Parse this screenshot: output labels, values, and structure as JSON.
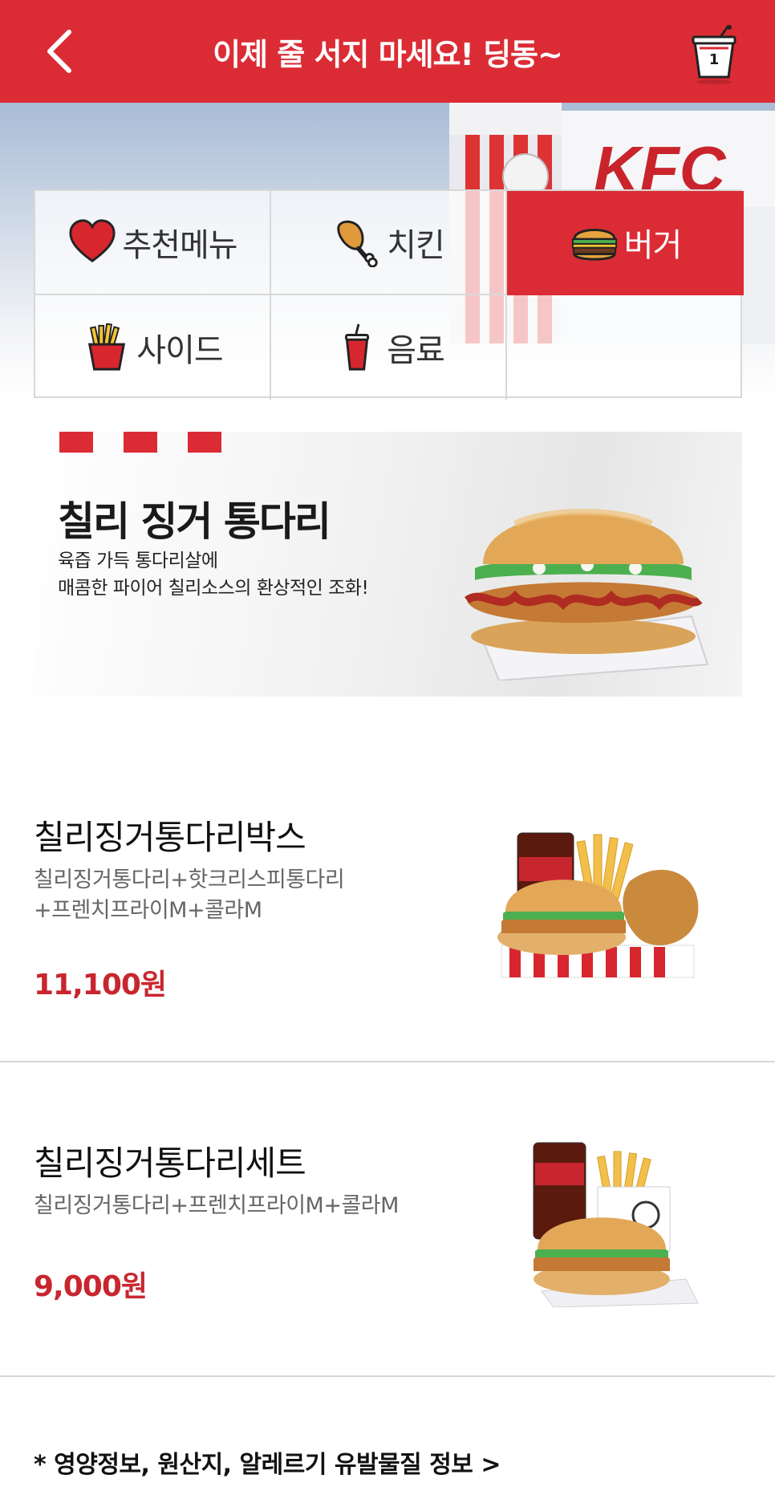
{
  "header": {
    "title": "이제 줄 서지 마세요! 딩동~",
    "cart_count": "1"
  },
  "hero": {
    "sign_text": "KFC"
  },
  "categories": [
    {
      "label": "추천메뉴",
      "icon": "heart-icon"
    },
    {
      "label": "치킨",
      "icon": "drumstick-icon"
    },
    {
      "label": "버거",
      "icon": "burger-icon",
      "active": true
    },
    {
      "label": "사이드",
      "icon": "fries-icon"
    },
    {
      "label": "음료",
      "icon": "drink-icon"
    }
  ],
  "banner": {
    "title": "칠리 징거 통다리",
    "desc_line1": "육즙 가득 통다리살에",
    "desc_line2": "매콤한 파이어 칠리소스의 환상적인 조화!"
  },
  "menu_items": [
    {
      "name": "칠리징거통다리박스",
      "desc_line1": "칠리징거통다리+핫크리스피통다리",
      "desc_line2": "+프렌치프라이M+콜라M",
      "price": "11,100원"
    },
    {
      "name": "칠리징거통다리세트",
      "desc_line1": "칠리징거통다리+프렌치프라이M+콜라M",
      "desc_line2": "",
      "price": "9,000원"
    }
  ],
  "footer": {
    "info_link": "* 영양정보, 원산지, 알레르기 유발물질 정보 >"
  },
  "colors": {
    "brand_red": "#db2c35",
    "price_red": "#c8262f"
  }
}
